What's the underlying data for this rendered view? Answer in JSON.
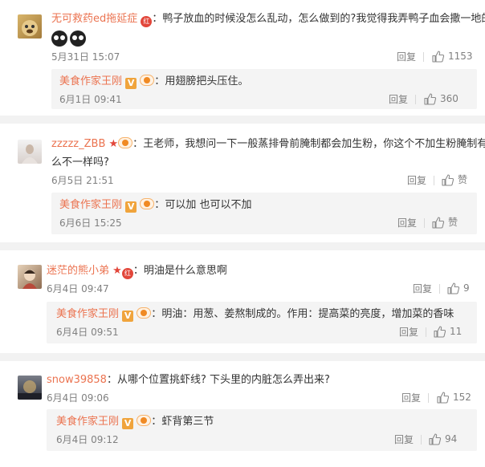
{
  "comments": [
    {
      "user": "无可救药ed拖延症",
      "badge_red": "红",
      "text": "鸭子放血的时候没怎么乱动，怎么做到的?我觉得我弄鸭子血会撒一地的",
      "time": "5月31日 15:07",
      "reply": "回复",
      "likes": "1153",
      "sub": {
        "user": "美食作家王刚",
        "v": "V",
        "text": "用翅膀把头压住。",
        "time": "6月1日 09:41",
        "reply": "回复",
        "likes": "360"
      }
    },
    {
      "user": "zzzzz_ZBB",
      "text_line1": "王老师，我想问一下一般蒸排骨前腌制都会加生粉，你这个不加生粉腌制有什",
      "text_line2": "么不一样吗?",
      "time": "6月5日 21:51",
      "reply": "回复",
      "likes": "赞",
      "sub": {
        "user": "美食作家王刚",
        "v": "V",
        "text": "可以加 也可以不加",
        "time": "6月6日 15:25",
        "reply": "回复",
        "likes": "赞"
      }
    },
    {
      "user": "迷茫的熊小弟",
      "badge_red": "红",
      "text": "明油是什么意思啊",
      "time": "6月4日 09:47",
      "reply": "回复",
      "likes": "9",
      "sub": {
        "user": "美食作家王刚",
        "v": "V",
        "text": "明油：用葱、姜熬制成的。作用：提高菜的亮度，增加菜的香味",
        "time": "6月4日 09:51",
        "reply": "回复",
        "likes": "11"
      }
    },
    {
      "user": "snow39858",
      "text": "从哪个位置挑虾线? 下头里的内脏怎么弄出来?",
      "time": "6月4日 09:06",
      "reply": "回复",
      "likes": "152",
      "sub": {
        "user": "美食作家王刚",
        "v": "V",
        "text": "虾背第三节",
        "time": "6月4日 09:12",
        "reply": "回复",
        "likes": "94"
      }
    }
  ],
  "colors": {
    "name": "#eb7350",
    "meta": "#808080",
    "subbox": "#f4f4f4",
    "gap": "#f2f2f2"
  },
  "icons": {
    "like": "thumb-up-icon",
    "emoji": "black-face-emoji-icon"
  }
}
